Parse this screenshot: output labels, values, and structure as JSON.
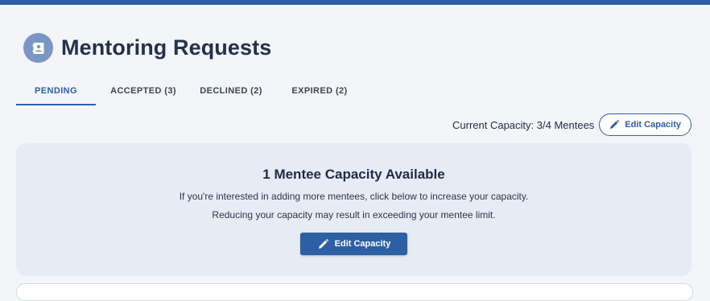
{
  "header": {
    "title": "Mentoring Requests",
    "icon": "contact-card-icon"
  },
  "tabs": [
    {
      "label": "PENDING",
      "active": true
    },
    {
      "label": "ACCEPTED (3)",
      "active": false
    },
    {
      "label": "DECLINED (2)",
      "active": false
    },
    {
      "label": "EXPIRED (2)",
      "active": false
    }
  ],
  "capacity": {
    "text": "Current Capacity: 3/4 Mentees",
    "edit_label": "Edit Capacity",
    "edit_icon": "pencil-icon"
  },
  "card": {
    "title": "1 Mentee Capacity Available",
    "line1": "If you're interested in adding more mentees, click below to increase your capacity.",
    "line2": "Reducing your capacity may result in exceeding your mentee limit.",
    "button_label": "Edit Capacity",
    "button_icon": "pencil-icon"
  },
  "colors": {
    "accent": "#2d5fa6",
    "background": "#f3f5f8",
    "card_background": "#e7ecf4",
    "header_icon_background": "#7a96c4"
  }
}
